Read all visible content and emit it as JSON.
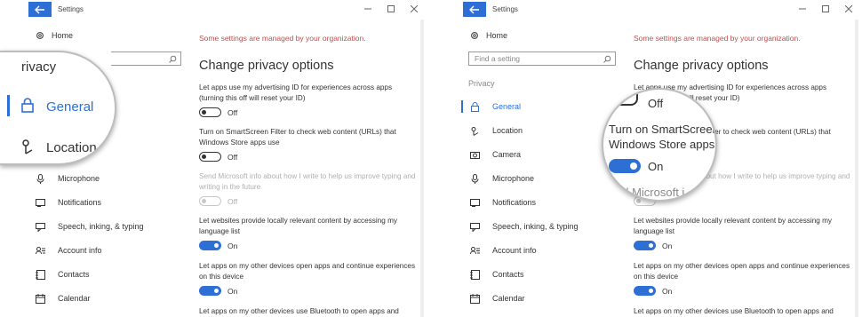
{
  "window": {
    "title": "Settings"
  },
  "sidebar": {
    "home_label": "Home",
    "search_placeholder": "Find a setting",
    "section_label": "Privacy",
    "items": [
      {
        "label": "General",
        "icon": "lock-icon",
        "active": true
      },
      {
        "label": "Location",
        "icon": "location-icon"
      },
      {
        "label": "Camera",
        "icon": "camera-icon"
      },
      {
        "label": "Microphone",
        "icon": "microphone-icon"
      },
      {
        "label": "Notifications",
        "icon": "notifications-icon"
      },
      {
        "label": "Speech, inking, & typing",
        "icon": "speech-icon"
      },
      {
        "label": "Account info",
        "icon": "account-info-icon"
      },
      {
        "label": "Contacts",
        "icon": "contacts-icon"
      },
      {
        "label": "Calendar",
        "icon": "calendar-icon"
      }
    ]
  },
  "main": {
    "managed_notice": "Some settings are managed by your organization.",
    "heading": "Change privacy options",
    "settings": [
      {
        "text": "Let apps use my advertising ID for experiences across apps (turning this off will reset your ID)",
        "state": "Off"
      },
      {
        "text": "Turn on SmartScreen Filter to check web content (URLs) that Windows Store apps use",
        "state_left": "Off",
        "state_right": "On"
      },
      {
        "text": "Send Microsoft info about how I write to help us improve typing and writing in the future",
        "state": "Off",
        "disabled": true
      },
      {
        "text": "Let websites provide locally relevant content by accessing my language list",
        "state": "On"
      },
      {
        "text": "Let apps on my other devices open apps and continue experiences on this device",
        "state": "On"
      },
      {
        "text": "Let apps on my other devices use Bluetooth to open apps and"
      }
    ]
  },
  "magnifier_left": {
    "heading_fragment": "rivacy",
    "active_label": "General",
    "next_label": "Location"
  },
  "magnifier_right": {
    "top_state": "Off",
    "line1": "Turn on SmartScreen",
    "line2": "Windows Store apps",
    "state": "On",
    "line3": "nd Microsoft i"
  },
  "colors": {
    "accent": "#2e6fd6",
    "managed_text": "#c0504d",
    "disabled_text": "#b0b0b0"
  }
}
